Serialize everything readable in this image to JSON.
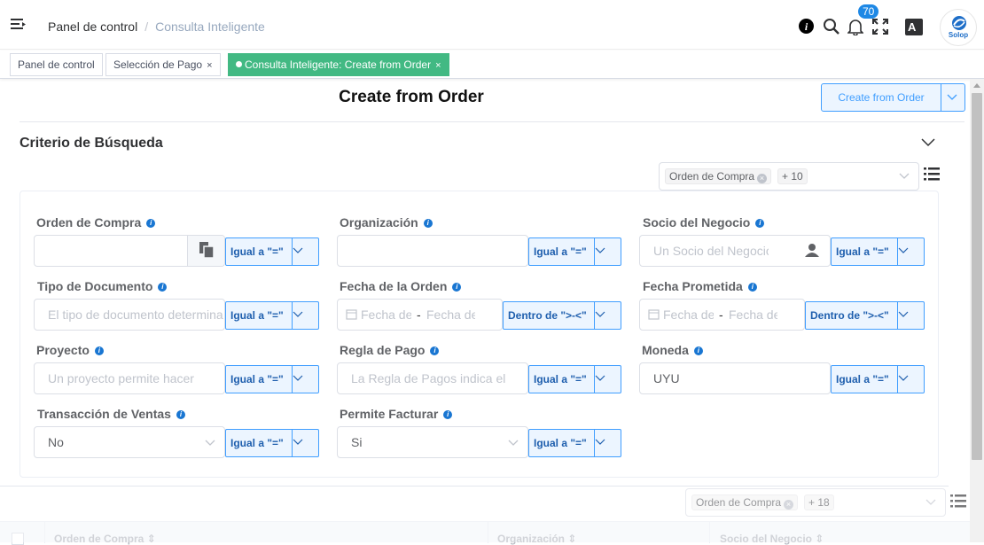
{
  "header": {
    "breadcrumb": [
      "Panel de control",
      "Consulta Inteligente"
    ],
    "notifications_count": "70",
    "avatar_text": "Solop",
    "lang_icon_text": "A",
    "icons": [
      "menu-icon",
      "info-icon",
      "search-icon",
      "bell-icon",
      "fullscreen-icon",
      "language-icon"
    ]
  },
  "tabs": [
    {
      "label": "Panel de control",
      "closable": false,
      "active": false
    },
    {
      "label": "Selección de Pago",
      "closable": true,
      "active": false
    },
    {
      "label": "Consulta Inteligente: Create from Order",
      "closable": true,
      "active": true
    }
  ],
  "tab_close_glyph": "×",
  "page": {
    "title": "Create from Order",
    "action_button": "Create from Order"
  },
  "search": {
    "title": "Criterio de Búsqueda",
    "field_selector": {
      "chip": "Orden de Compra",
      "more": "+ 10"
    },
    "fields": {
      "orden_compra": {
        "label": "Orden de Compra",
        "value": "",
        "operator": "Igual a \"=\""
      },
      "organizacion": {
        "label": "Organización",
        "value": "",
        "operator": "Igual a \"=\""
      },
      "socio_negocio": {
        "label": "Socio del Negocio",
        "placeholder": "Un Socio del Negocio",
        "operator": "Igual a \"=\""
      },
      "tipo_documento": {
        "label": "Tipo de Documento",
        "placeholder": "El tipo de documento determina",
        "operator": "Igual a \"=\""
      },
      "fecha_orden": {
        "label": "Fecha de la Orden",
        "start_placeholder": "Fecha de",
        "end_placeholder": "Fecha de",
        "separator": "-",
        "operator": "Dentro de \">-<\""
      },
      "fecha_prometida": {
        "label": "Fecha Prometida",
        "start_placeholder": "Fecha de",
        "end_placeholder": "Fecha de",
        "separator": "-",
        "operator": "Dentro de \">-<\""
      },
      "proyecto": {
        "label": "Proyecto",
        "placeholder": "Un proyecto permite hacer",
        "operator": "Igual a \"=\""
      },
      "regla_pago": {
        "label": "Regla de Pago",
        "placeholder": "La Regla de Pagos indica el",
        "operator": "Igual a \"=\""
      },
      "moneda": {
        "label": "Moneda",
        "value": "UYU",
        "operator": "Igual a \"=\""
      },
      "transaccion_ventas": {
        "label": "Transacción de Ventas",
        "value": "No",
        "operator": "Igual a \"=\""
      },
      "permite_facturar": {
        "label": "Permite Facturar",
        "value": "Si",
        "operator": "Igual a \"=\""
      }
    }
  },
  "table": {
    "column_selector": {
      "chip": "Orden de Compra",
      "more": "+ 18"
    },
    "columns": [
      "Orden de Compra",
      "Organización",
      "Socio del Negocio"
    ]
  },
  "colors": {
    "accent": "#409eff",
    "active_tab": "#42b983",
    "badge": "#1e88e5"
  }
}
